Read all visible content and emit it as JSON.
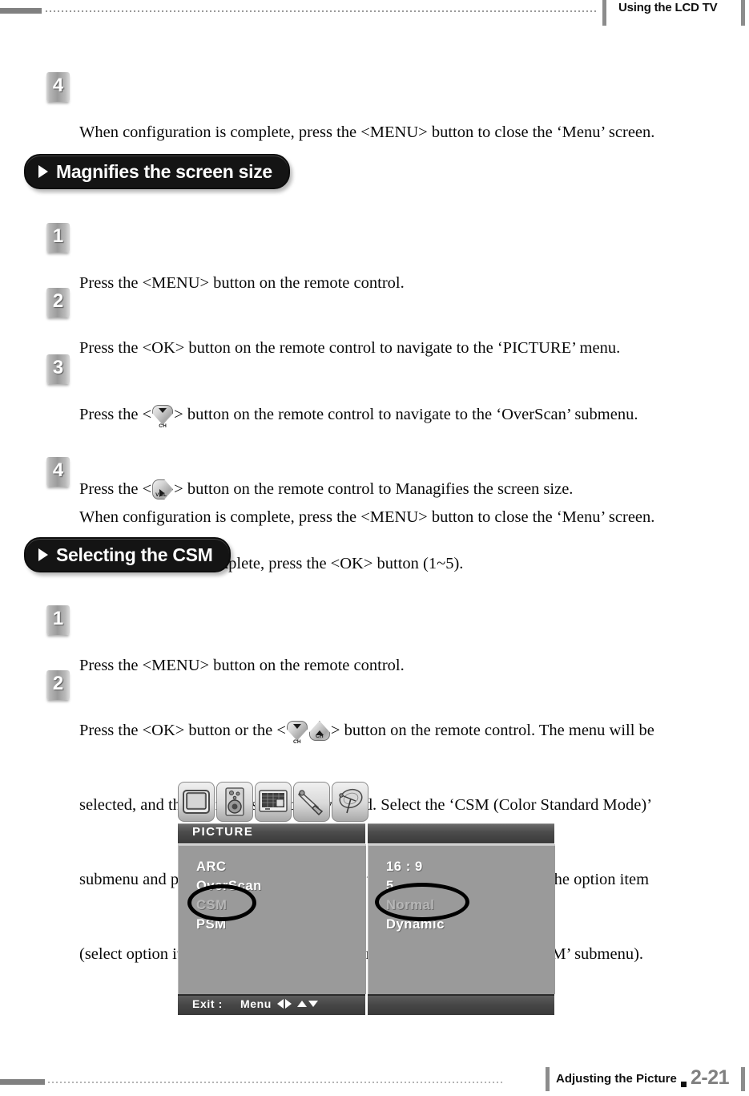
{
  "header": {
    "title": "Using the LCD TV"
  },
  "footer": {
    "section": "Adjusting the Picture",
    "page": "2-21"
  },
  "steps_top": [
    {
      "number": "4",
      "lines": [
        "When configuration is complete, press the <MENU> button to close the ‘Menu’ screen."
      ]
    }
  ],
  "sections": [
    {
      "id": "magnifies",
      "title": "Magnifies the screen size",
      "steps": [
        {
          "number": "1",
          "lines": [
            "Press the <MENU> button on the remote control."
          ]
        },
        {
          "number": "2",
          "lines": [
            "Press the <OK> button on the remote control to navigate to the ‘PICTURE’ menu."
          ]
        },
        {
          "number": "3",
          "lines": [
            "Press the < [CH-DOWN] > button on the remote control to navigate to the ‘OverScan’ submenu.",
            "Press the < [VOL-RIGHT] > button on the remote control to Managifies the screen size.",
            "When selection is complete, press the <OK> button (1~5)."
          ]
        },
        {
          "number": "4",
          "lines": [
            "When configuration is complete, press the <MENU> button to close the ‘Menu’ screen."
          ]
        }
      ]
    },
    {
      "id": "csm",
      "title": "Selecting the CSM",
      "steps": [
        {
          "number": "1",
          "lines": [
            "Press the <MENU> button on the remote control."
          ]
        },
        {
          "number": "2",
          "lines": [
            "Press the <OK> button or the < [CH-DOWN] [CH-UP] > button on the remote control. The menu will be",
            "selected, and the submenus can be navigated. Select the ‘CSM (Color Standard Mode)’",
            "submenu and press the < [VOL-LEFT] [VOL-RIGHT] > button on the remote control to select the option item",
            "(select option items like ‘Normal, Cool, Warm1~2’ and so on in the ‘CSM’ submenu)."
          ]
        }
      ]
    }
  ],
  "osd": {
    "tabs": [
      {
        "name": "tv-icon",
        "label": "Picture"
      },
      {
        "name": "speaker-icon",
        "label": "Sound"
      },
      {
        "name": "screen-icon",
        "label": "Screen"
      },
      {
        "name": "tool-icon",
        "label": "Setup"
      },
      {
        "name": "satellite-dish-icon",
        "label": "Channel"
      }
    ],
    "title": "PICTURE",
    "rows": [
      {
        "label": "ARC",
        "value": "16 : 9",
        "highlighted": false
      },
      {
        "label": "OverScan",
        "value": "5",
        "highlighted": false
      },
      {
        "label": "CSM",
        "value": "Normal",
        "highlighted": true
      },
      {
        "label": "PSM",
        "value": "Dynamic",
        "highlighted": false
      }
    ],
    "bottom": {
      "exit_label": "Exit :",
      "menu_label": "Menu"
    }
  },
  "colors": {
    "pill_bg": "#141414",
    "badge_gray": "#9a9a9a",
    "osd_panel": "#9a9a9a",
    "osd_bar": "#474747",
    "page_number": "#808080"
  }
}
